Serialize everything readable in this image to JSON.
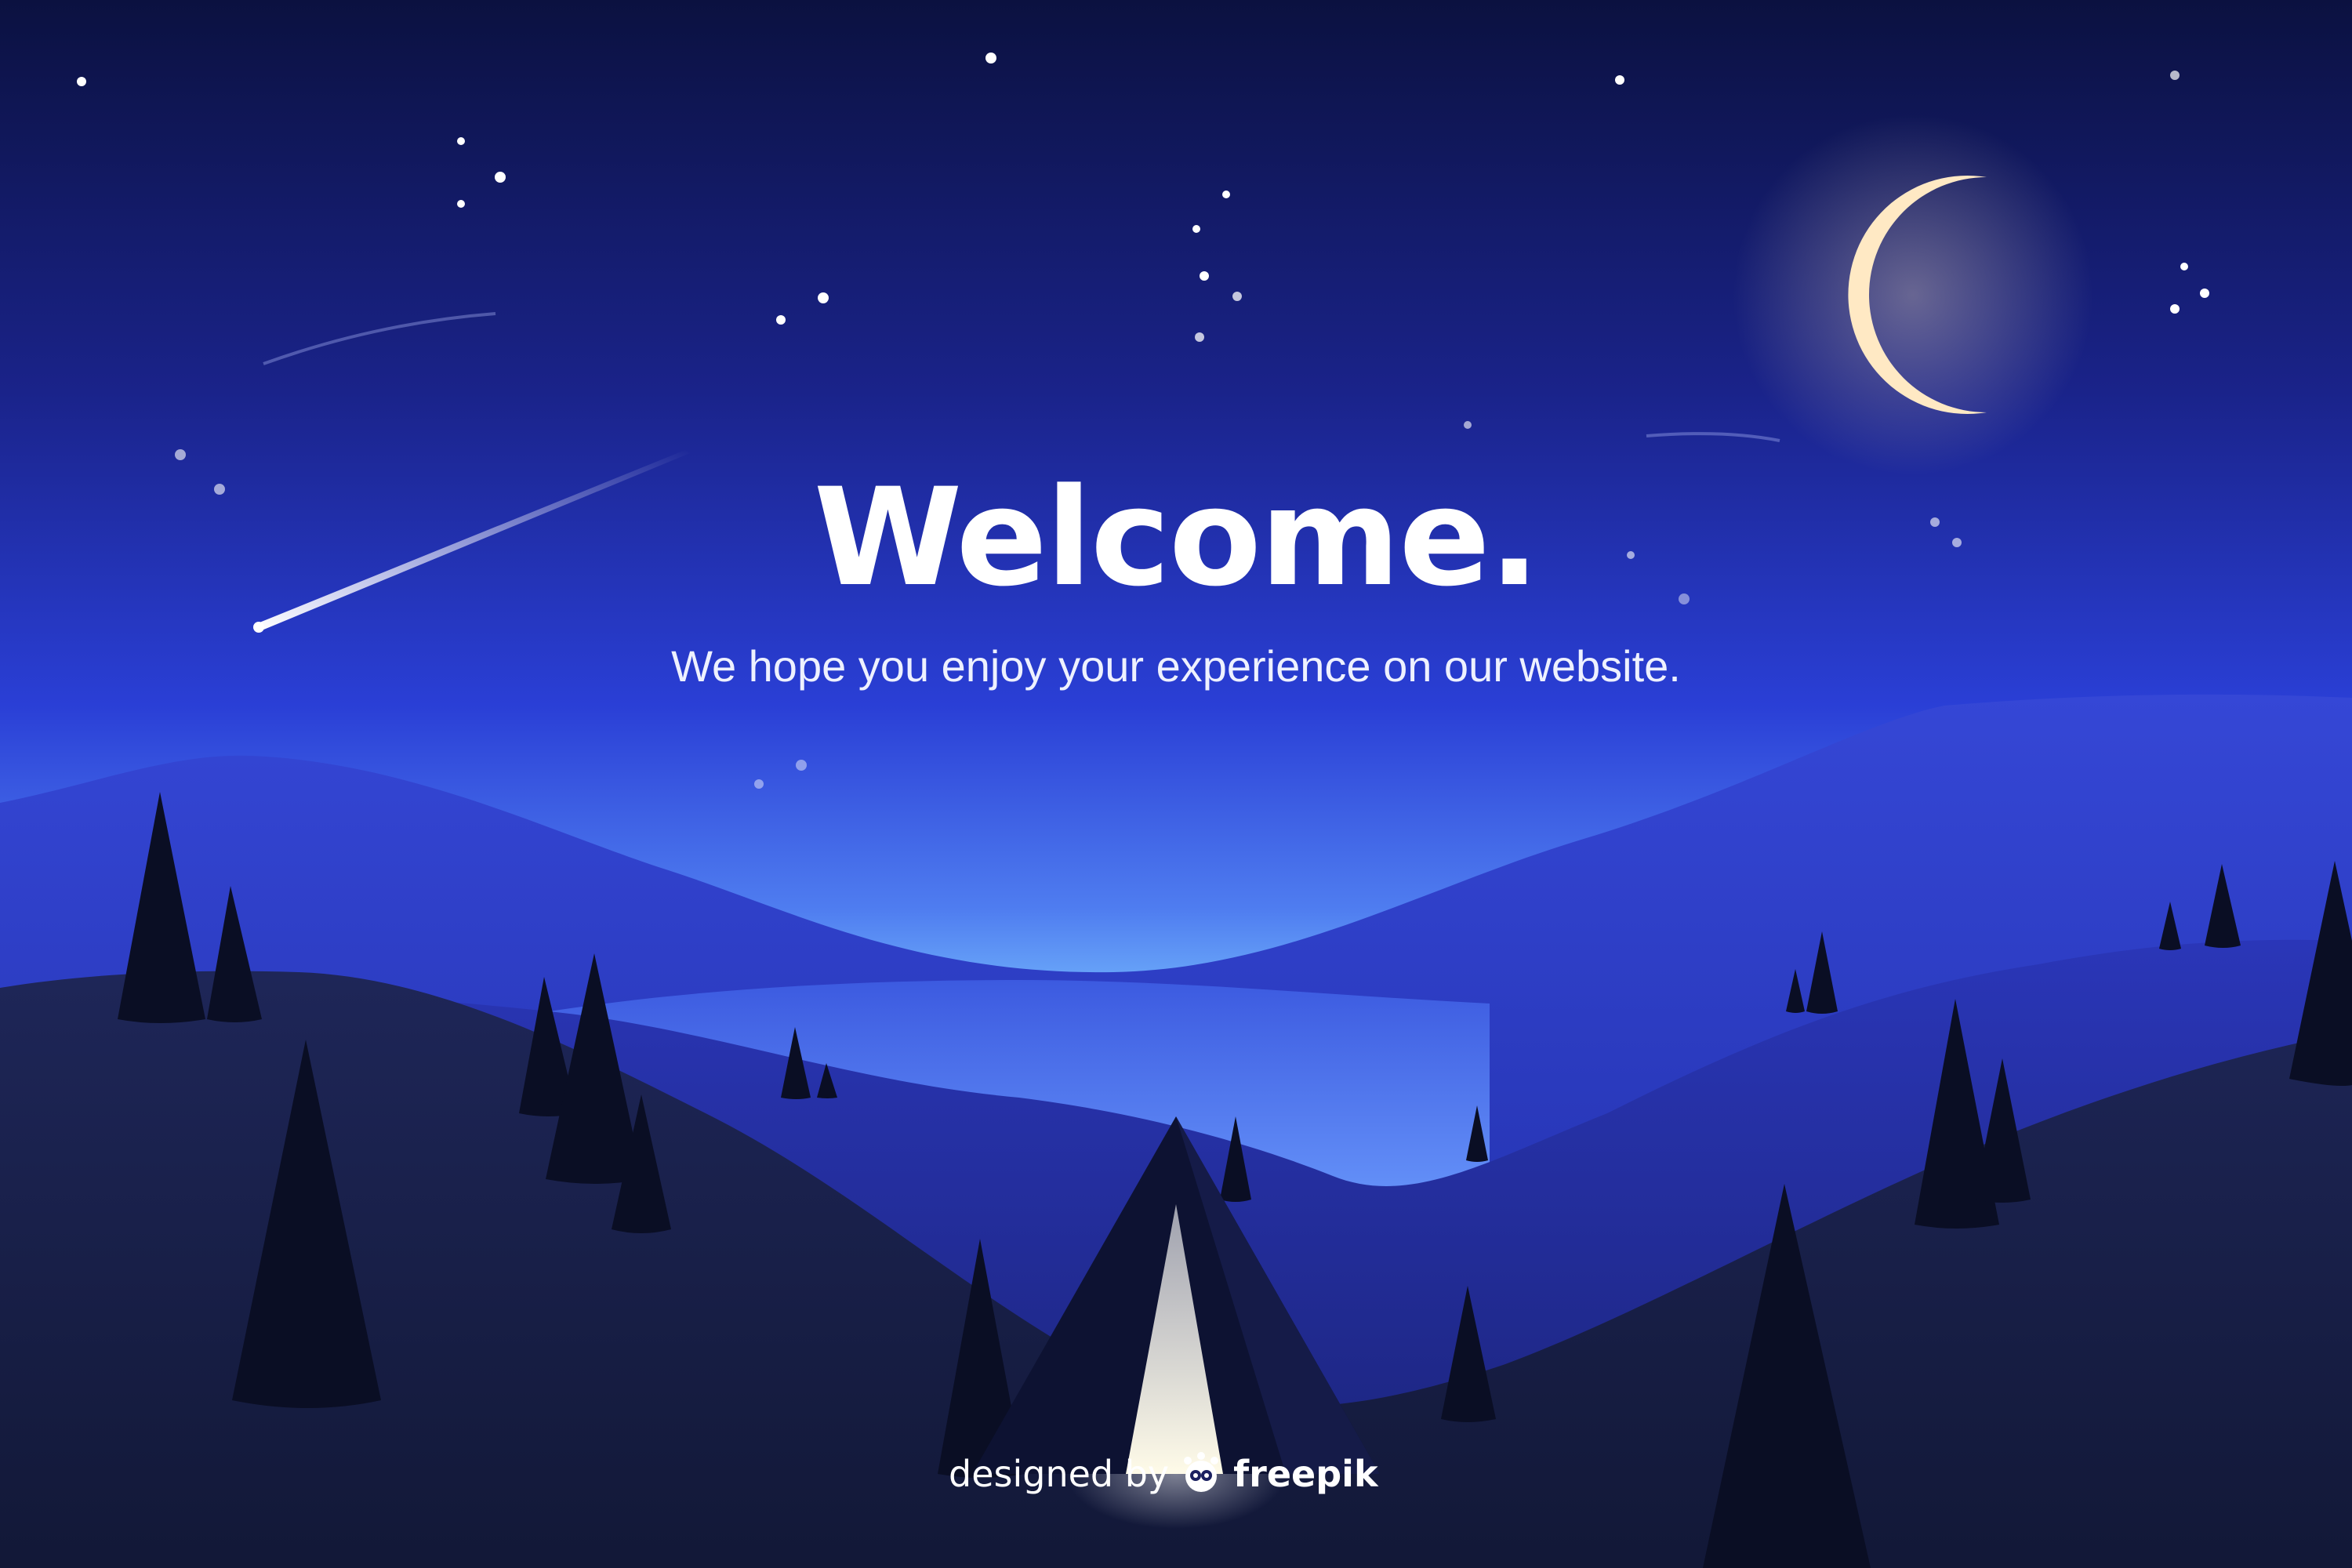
{
  "headline": "Welcome.",
  "tagline": "We hope you enjoy your experience on our website.",
  "credit": {
    "lead": "designed by",
    "icon": "freepik-logo-icon",
    "brand": "freepik"
  },
  "illustration": {
    "moon": "crescent-moon-icon",
    "meteors": "shooting-star-icon",
    "stars": "star-icon",
    "tent": "tent-icon",
    "trees": "pine-tree-icon"
  },
  "colors": {
    "sky_top": "#0b1140",
    "sky_mid": "#2a3fd6",
    "horizon_glow": "#7cc4ff",
    "moon": "#ffe9c4",
    "hills_far": "#2432b5",
    "hills_mid": "#1c2688",
    "hills_near": "#151c45",
    "trees": "#0a0e24",
    "text": "#ffffff"
  }
}
